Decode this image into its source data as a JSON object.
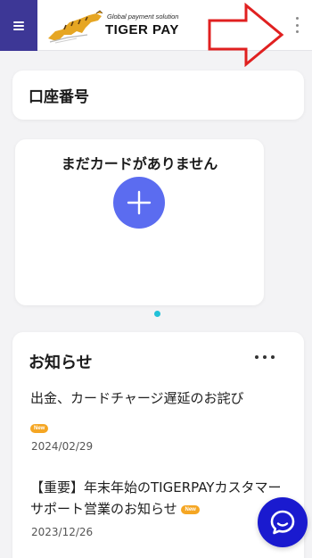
{
  "header": {
    "logo": {
      "tagline": "Global payment solution",
      "name": "TIGER PAY"
    }
  },
  "account": {
    "title": "口座番号"
  },
  "cards": {
    "empty_text": "まだカードがありません"
  },
  "news": {
    "title": "お知らせ",
    "badge_text": "New",
    "items": [
      {
        "title": "出金、カードチャージ遅延のお詫び",
        "date": "2024/02/29"
      },
      {
        "title": "【重要】年末年始のTIGERPAYカスタマーサポート営業のお知らせ",
        "date": "2023/12/26"
      }
    ]
  },
  "icons": {
    "menu": "hamburger-icon",
    "more": "kebab-menu-icon",
    "annotation": "red-arrow",
    "add": "plus-icon",
    "chat": "chat-bubble-icon"
  },
  "colors": {
    "menu_bg": "#3d3796",
    "add_button": "#5b6cf0",
    "carousel_dot": "#22c1d8",
    "new_badge": "#f5a623",
    "chat_button": "#1a1acf",
    "annotation_arrow": "#e02020"
  }
}
